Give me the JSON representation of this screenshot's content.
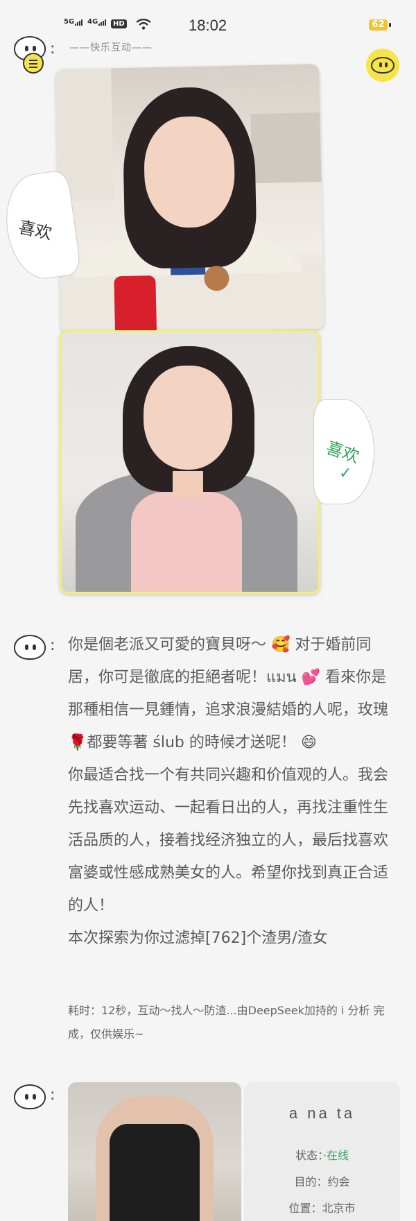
{
  "status_bar": {
    "signal1": "5G",
    "signal2": "4G",
    "hd": "HD",
    "time": "18:02",
    "battery": "62"
  },
  "header": {
    "subtitle": "——快乐互动——"
  },
  "cards": [
    {
      "tag": "喜欢"
    },
    {
      "tag": "喜欢",
      "check": "✓"
    }
  ],
  "colon": ":",
  "result": {
    "paragraphs": [
      "你是個老派又可愛的寶貝呀～ 🥰 对于婚前同居，你可是徹底的拒絕者呢！แมน 💕 看來你是那種相信一見鍾情，追求浪漫結婚的人呢，玫瑰🌹都要等著 ślub 的時候才送呢！ 😄",
      "你最适合找一个有共同兴趣和价值观的人。我会先找喜欢运动、一起看日出的人，再找注重性生活品质的人，接着找经济独立的人，最后找喜欢富婆或性感成熟美女的人。希望你找到真正合适的人！",
      "本次探索为你过滤掉[762]个渣男/渣女"
    ],
    "meta": "耗时：12秒，互动～找人～防渣...由DeepSeek加持的 i 分析 完成，仅供娱乐~"
  },
  "profile": {
    "name": "a na ta",
    "status_label": "状态：",
    "status_value": "·在线",
    "purpose_label": "目的：",
    "purpose_value": "约会",
    "location_label": "位置：",
    "location_value": "北京市"
  }
}
